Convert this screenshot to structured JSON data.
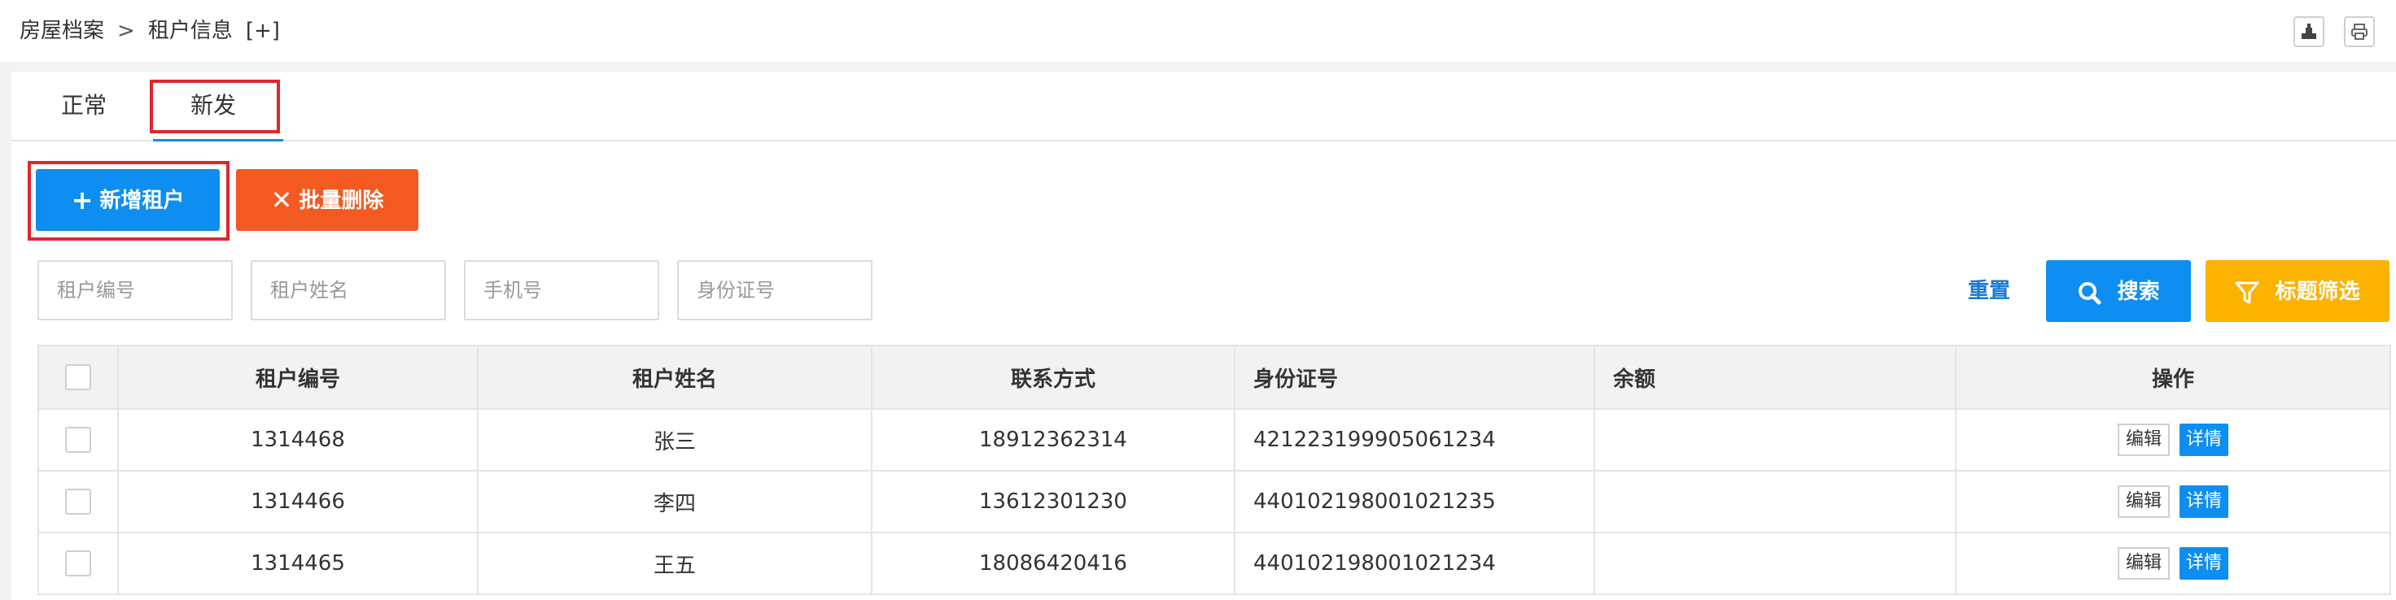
{
  "breadcrumb": {
    "root": "房屋档案",
    "separator": ">",
    "current": "租户信息",
    "add": "[+]"
  },
  "toolbar": {
    "icons": [
      "export-icon",
      "print-icon"
    ]
  },
  "tabs": [
    {
      "label": "正常",
      "active": false
    },
    {
      "label": "新发",
      "active": true
    }
  ],
  "actions": {
    "add_label": "新增租户",
    "delete_label": "批量删除"
  },
  "filters": {
    "tenant_no_placeholder": "租户编号",
    "tenant_name_placeholder": "租户姓名",
    "phone_placeholder": "手机号",
    "id_card_placeholder": "身份证号",
    "reset_label": "重置",
    "search_label": "搜索",
    "column_filter_label": "标题筛选"
  },
  "table": {
    "headers": [
      "租户编号",
      "租户姓名",
      "联系方式",
      "身份证号",
      "余额",
      "操作"
    ],
    "rows": [
      {
        "tenant_no": "1314468",
        "name": "张三",
        "phone": "18912362314",
        "id_card": "421223199905061234",
        "balance": ""
      },
      {
        "tenant_no": "1314466",
        "name": "李四",
        "phone": "13612301230",
        "id_card": "440102198001021235",
        "balance": ""
      },
      {
        "tenant_no": "1314465",
        "name": "王五",
        "phone": "18086420416",
        "id_card": "440102198001021234",
        "balance": ""
      }
    ],
    "edit_label": "编辑",
    "detail_label": "详情"
  },
  "colors": {
    "primary": "#0e8ef0",
    "danger": "#f25a22",
    "warning": "#fbb300",
    "highlight": "#e0262e",
    "link": "#1779d3"
  }
}
